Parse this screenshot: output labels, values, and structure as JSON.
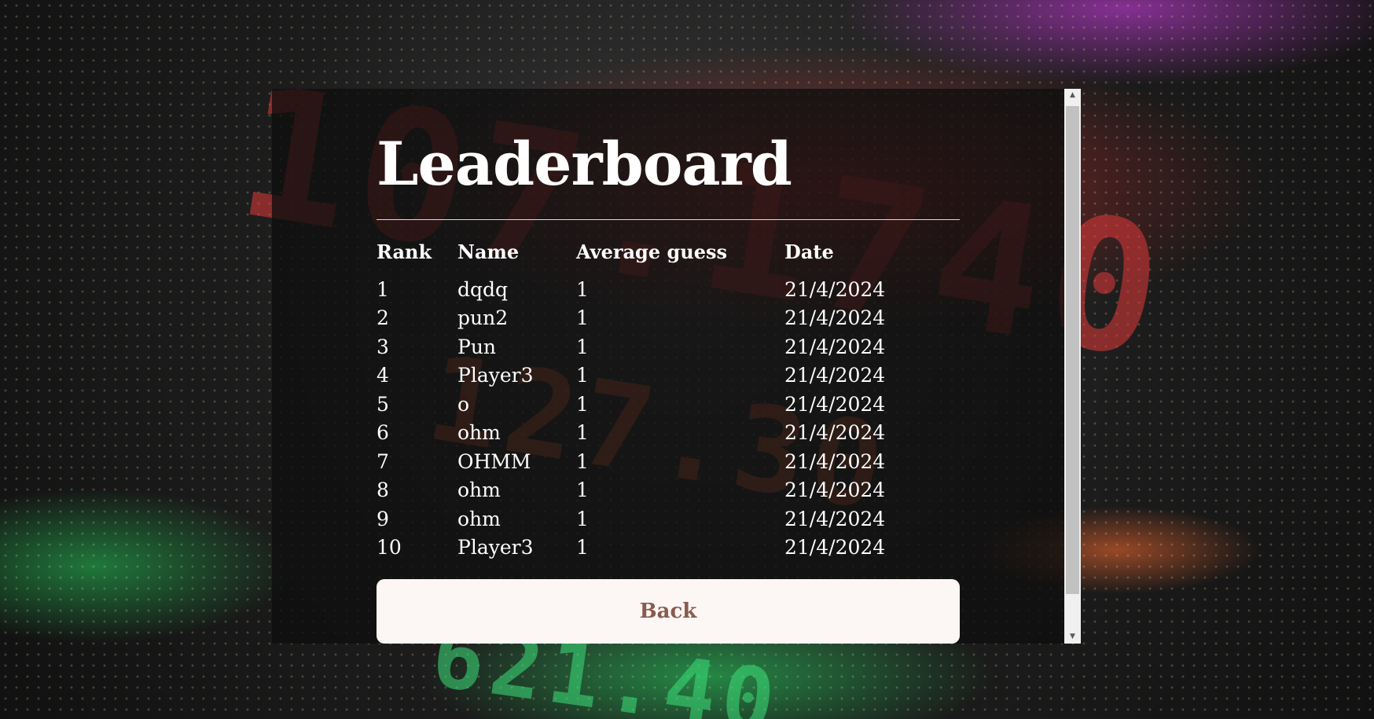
{
  "leaderboard": {
    "title": "Leaderboard",
    "columns": {
      "rank": "Rank",
      "name": "Name",
      "average": "Average guess",
      "date": "Date"
    },
    "rows": [
      {
        "rank": "1",
        "name": "dqdq",
        "average": "1",
        "date": "21/4/2024"
      },
      {
        "rank": "2",
        "name": "pun2",
        "average": "1",
        "date": "21/4/2024"
      },
      {
        "rank": "3",
        "name": "Pun",
        "average": "1",
        "date": "21/4/2024"
      },
      {
        "rank": "4",
        "name": "Player3",
        "average": "1",
        "date": "21/4/2024"
      },
      {
        "rank": "5",
        "name": "o",
        "average": "1",
        "date": "21/4/2024"
      },
      {
        "rank": "6",
        "name": "ohm",
        "average": "1",
        "date": "21/4/2024"
      },
      {
        "rank": "7",
        "name": "OHMM",
        "average": "1",
        "date": "21/4/2024"
      },
      {
        "rank": "8",
        "name": "ohm",
        "average": "1",
        "date": "21/4/2024"
      },
      {
        "rank": "9",
        "name": "ohm",
        "average": "1",
        "date": "21/4/2024"
      },
      {
        "rank": "10",
        "name": "Player3",
        "average": "1",
        "date": "21/4/2024"
      }
    ],
    "back_label": "Back"
  },
  "scrollbar": {
    "up_icon": "scroll-up-arrow-icon",
    "down_icon": "scroll-down-arrow-icon"
  },
  "colors": {
    "panel_bg": "#0e0e0e",
    "button_bg": "#fcf6f4",
    "button_text": "#8a5a4e",
    "text": "#ffffff"
  }
}
